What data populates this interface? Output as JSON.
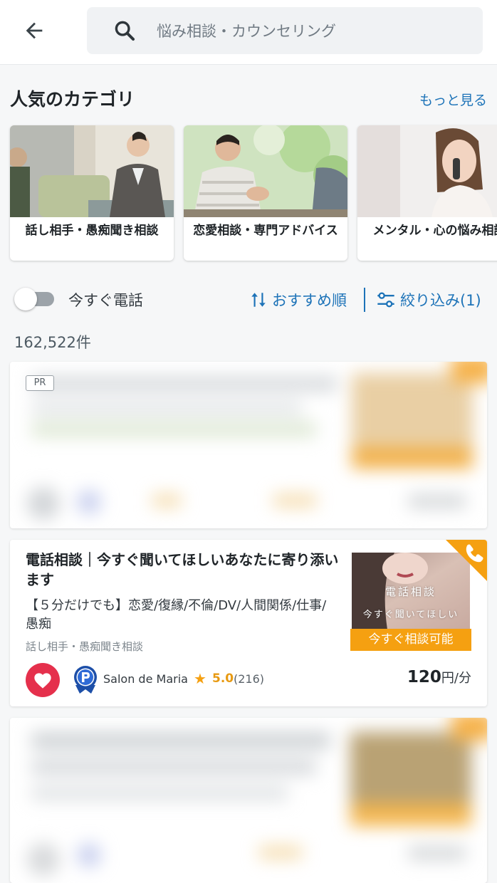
{
  "search": {
    "placeholder": "悩み相談・カウンセリング"
  },
  "categories": {
    "title": "人気のカテゴリ",
    "more_label": "もっと見る",
    "items": [
      {
        "label": "話し相手・愚痴聞き相談"
      },
      {
        "label": "恋愛相談・専門アドバイス"
      },
      {
        "label": "メンタル・心の悩み相談"
      }
    ]
  },
  "filters": {
    "call_now_label": "今すぐ電話",
    "call_now_on": false,
    "sort_label": "おすすめ順",
    "filter_label": "絞り込み(1)"
  },
  "results": {
    "count": "162,522件"
  },
  "ad_card": {
    "badge": "PR"
  },
  "listing": {
    "title": "電話相談｜今すぐ聞いてほしいあなたに寄り添います",
    "description": "【５分だけでも】恋愛/復縁/不倫/DV/人間関係/仕事/愚痴",
    "category": "話し相手・愚痴聞き相談",
    "thumb_text1": "電話相談",
    "thumb_text2": "今すぐ聞いてほしい",
    "availability": "今すぐ相談可能",
    "seller": "Salon de Maria",
    "rating": "5.0",
    "review_count": "(216)",
    "price": "120",
    "price_unit": "円/分"
  },
  "colors": {
    "accent": "#1d73b8",
    "badge_orange": "#f5a011",
    "favorite_red": "#e5304c"
  }
}
